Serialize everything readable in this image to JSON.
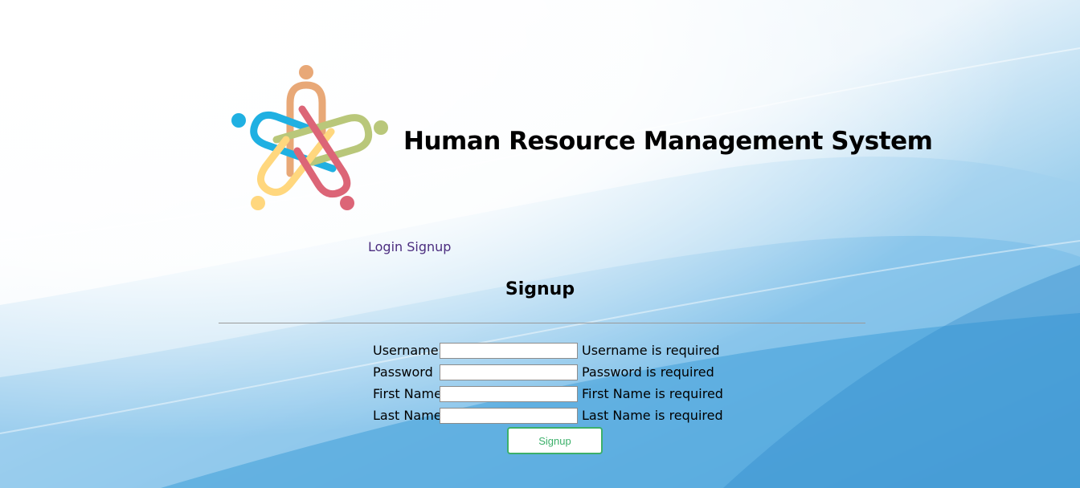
{
  "header": {
    "app_title": "Human Resource Management System",
    "logo_icon": "people-paperclip-logo-icon"
  },
  "nav": {
    "login_label": "Login",
    "signup_label": "Signup"
  },
  "form": {
    "title": "Signup",
    "fields": [
      {
        "label": "Username",
        "value": "",
        "error": "Username is required"
      },
      {
        "label": "Password",
        "value": "",
        "error": "Password is required"
      },
      {
        "label": "First Name",
        "value": "",
        "error": "First Name is required"
      },
      {
        "label": "Last Name",
        "value": "",
        "error": "Last Name is required"
      }
    ],
    "submit_label": "Signup"
  },
  "colors": {
    "nav_link": "#4b2d7f",
    "button_accent": "#3cb06a",
    "background_blue": "#3f9ed8",
    "logo_orange": "#e8a877",
    "logo_blue": "#1fb0e2",
    "logo_green": "#b9c77a",
    "logo_yellow": "#ffd77e",
    "logo_red": "#dc6577"
  }
}
